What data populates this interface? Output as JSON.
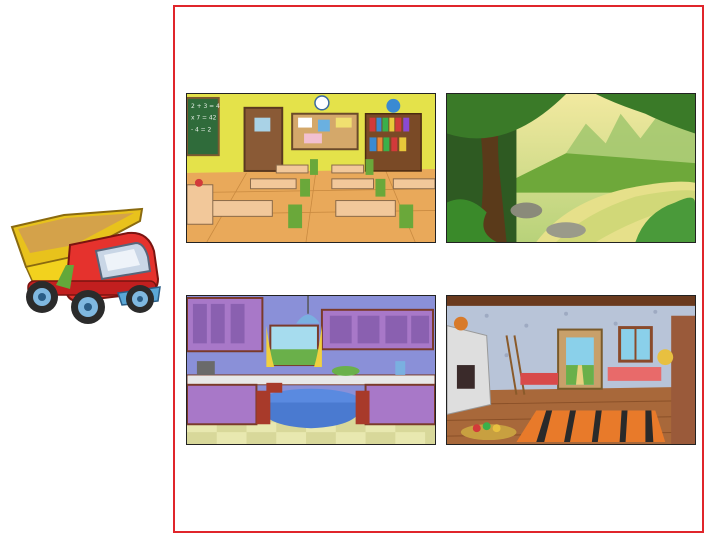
{
  "slide": {
    "frame_color": "#e0252b",
    "truck": {
      "icon": "toy-dump-truck-icon"
    },
    "scenes": [
      {
        "name": "classroom",
        "icon": "classroom-scene-image",
        "board_lines": [
          "2 + 3 = 4",
          "x 7 = 42",
          "- 4 = 2"
        ]
      },
      {
        "name": "jungle",
        "icon": "jungle-river-scene-image"
      },
      {
        "name": "kitchen",
        "icon": "kitchen-scene-image"
      },
      {
        "name": "cottage-room",
        "icon": "cottage-interior-scene-image"
      }
    ]
  }
}
